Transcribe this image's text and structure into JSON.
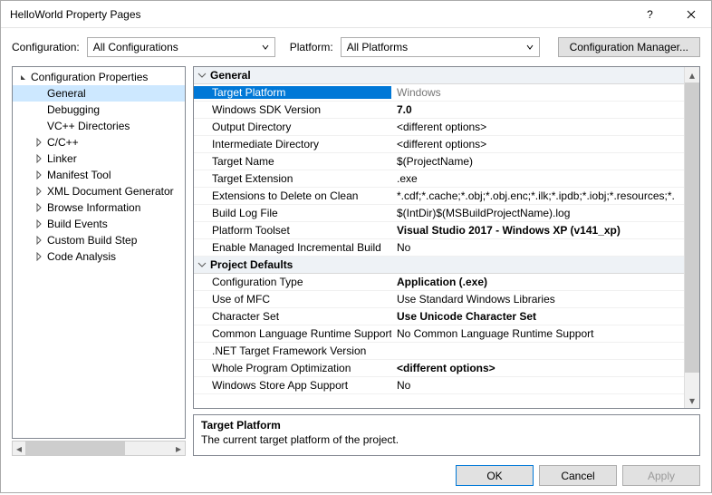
{
  "window": {
    "title": "HelloWorld Property Pages"
  },
  "toolbar": {
    "config_label": "Configuration:",
    "config_value": "All Configurations",
    "platform_label": "Platform:",
    "platform_value": "All Platforms",
    "configmgr_label": "Configuration Manager..."
  },
  "tree": {
    "root": "Configuration Properties",
    "items": [
      {
        "label": "General",
        "expand": "",
        "selected": true
      },
      {
        "label": "Debugging",
        "expand": ""
      },
      {
        "label": "VC++ Directories",
        "expand": ""
      },
      {
        "label": "C/C++",
        "expand": ">"
      },
      {
        "label": "Linker",
        "expand": ">"
      },
      {
        "label": "Manifest Tool",
        "expand": ">"
      },
      {
        "label": "XML Document Generator",
        "expand": ">"
      },
      {
        "label": "Browse Information",
        "expand": ">"
      },
      {
        "label": "Build Events",
        "expand": ">"
      },
      {
        "label": "Custom Build Step",
        "expand": ">"
      },
      {
        "label": "Code Analysis",
        "expand": ">"
      }
    ]
  },
  "grid": {
    "sections": [
      {
        "title": "General",
        "rows": [
          {
            "name": "Target Platform",
            "value": "Windows",
            "selected": true,
            "dim": true
          },
          {
            "name": "Windows SDK Version",
            "value": "7.0",
            "bold": true
          },
          {
            "name": "Output Directory",
            "value": "<different options>"
          },
          {
            "name": "Intermediate Directory",
            "value": "<different options>"
          },
          {
            "name": "Target Name",
            "value": "$(ProjectName)"
          },
          {
            "name": "Target Extension",
            "value": ".exe"
          },
          {
            "name": "Extensions to Delete on Clean",
            "value": "*.cdf;*.cache;*.obj;*.obj.enc;*.ilk;*.ipdb;*.iobj;*.resources;*."
          },
          {
            "name": "Build Log File",
            "value": "$(IntDir)$(MSBuildProjectName).log"
          },
          {
            "name": "Platform Toolset",
            "value": "Visual Studio 2017 - Windows XP (v141_xp)",
            "bold": true
          },
          {
            "name": "Enable Managed Incremental Build",
            "value": "No"
          }
        ]
      },
      {
        "title": "Project Defaults",
        "rows": [
          {
            "name": "Configuration Type",
            "value": "Application (.exe)",
            "bold": true
          },
          {
            "name": "Use of MFC",
            "value": "Use Standard Windows Libraries"
          },
          {
            "name": "Character Set",
            "value": "Use Unicode Character Set",
            "bold": true
          },
          {
            "name": "Common Language Runtime Support",
            "value": "No Common Language Runtime Support"
          },
          {
            "name": ".NET Target Framework Version",
            "value": ""
          },
          {
            "name": "Whole Program Optimization",
            "value": "<different options>",
            "bold": true
          },
          {
            "name": "Windows Store App Support",
            "value": "No"
          }
        ]
      }
    ]
  },
  "desc": {
    "title": "Target Platform",
    "text": "The current target platform of the project."
  },
  "footer": {
    "ok": "OK",
    "cancel": "Cancel",
    "apply": "Apply"
  }
}
